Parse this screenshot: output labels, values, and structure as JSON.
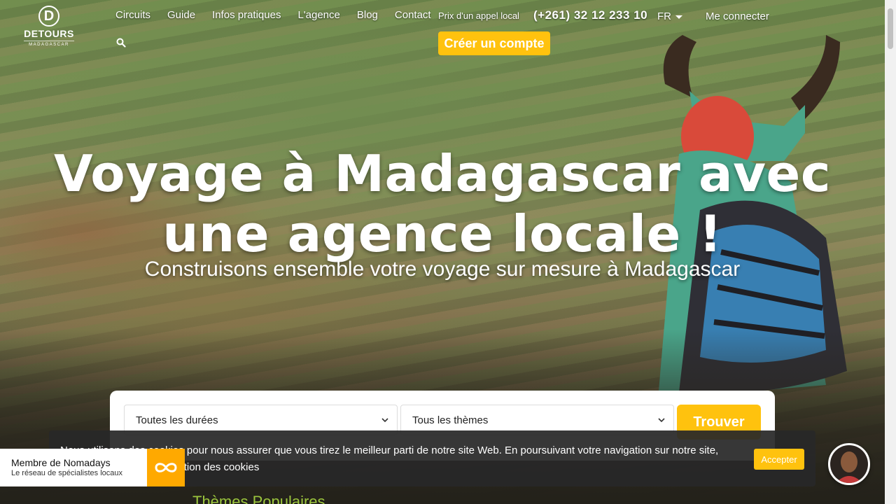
{
  "brand": {
    "name": "DETOURS",
    "sub": "MADAGASCAR",
    "mark": "D"
  },
  "nav": {
    "items": [
      "Circuits",
      "Guide",
      "Infos pratiques",
      "L'agence",
      "Blog",
      "Contact"
    ]
  },
  "header": {
    "phone_label": "Prix d'un appel local",
    "phone_number": "(+261) 32 12 233 10",
    "language": "FR",
    "login": "Me connecter",
    "create_account": "Créer un compte"
  },
  "hero": {
    "title": "Voyage à Madagascar avec une agence locale !",
    "subtitle": "Construisons ensemble votre voyage sur mesure à Madagascar"
  },
  "search": {
    "duration_value": "Toutes les durées",
    "theme_value": "Tous les thèmes",
    "submit": "Trouver"
  },
  "cookie": {
    "text": "Nous utilisons des cookies pour nous assurer que vous tirez le meilleur parti de notre site Web. En poursuivant votre navigation sur notre site, vous acceptez notre utilisation des cookies",
    "accept": "Accepter"
  },
  "nomadays": {
    "title": "Membre de Nomadays",
    "subtitle": "Le réseau de spécialistes locaux"
  },
  "footer_peek": "Thèmes Populaires",
  "colors": {
    "accent": "#ffc20e",
    "nomadays_orange": "#ffa900",
    "cookie_bg": "#282828"
  }
}
